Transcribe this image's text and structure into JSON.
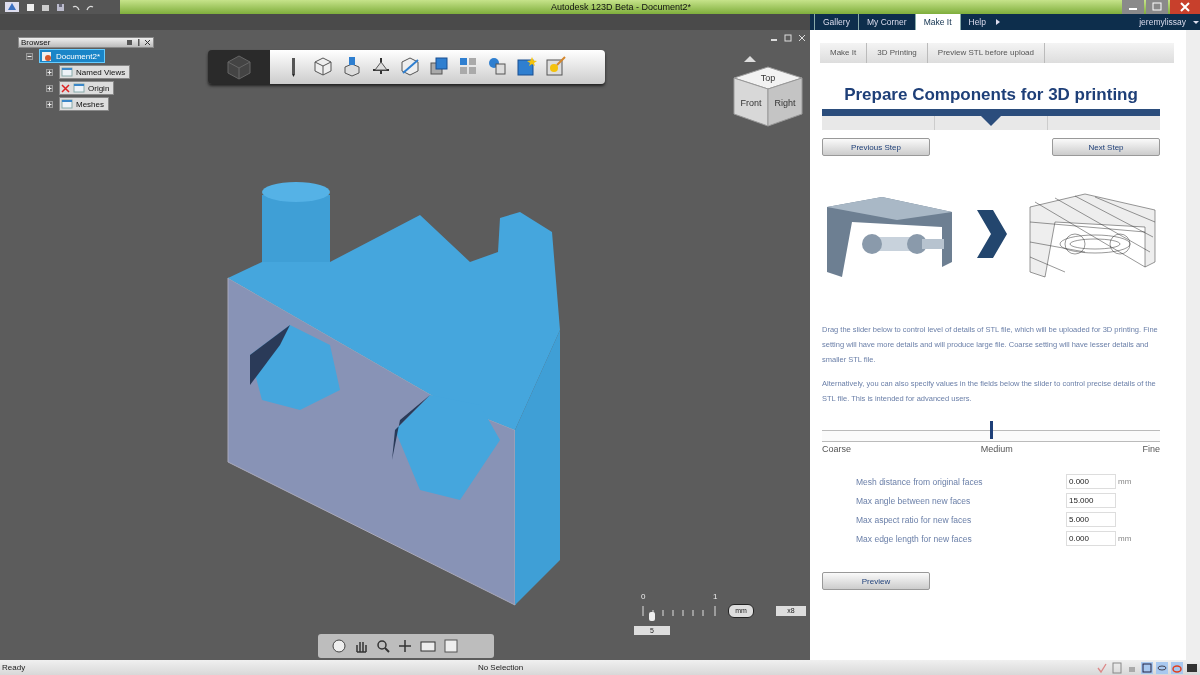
{
  "title_bar": {
    "title": "Autodesk 123D Beta - Document2*"
  },
  "browser": {
    "title": "Browser",
    "tree": [
      {
        "label": "Document2*",
        "selected": true,
        "expanded": true,
        "children": [
          {
            "label": "Named Views",
            "selected": false,
            "expanded": false
          },
          {
            "label": "Origin",
            "selected": false,
            "expanded": false
          },
          {
            "label": "Meshes",
            "selected": false,
            "expanded": false
          }
        ]
      }
    ]
  },
  "view_cube": {
    "faces": [
      "Top",
      "Front",
      "Right"
    ]
  },
  "scale_widget": {
    "ticks": [
      "0",
      "1"
    ],
    "value": "5",
    "unit": "mm",
    "zoom": "x8"
  },
  "web_tabs": [
    {
      "label": "Gallery",
      "selected": false
    },
    {
      "label": "My Corner",
      "selected": false
    },
    {
      "label": "Make It",
      "selected": true
    },
    {
      "label": "Help",
      "selected": false
    }
  ],
  "user": "jeremylissay",
  "breadcrumbs": [
    "Make It",
    "3D Printing",
    "Preview STL before upload"
  ],
  "heading": "Prepare Components for 3D printing",
  "steps": [
    {
      "selected": false
    },
    {
      "selected": true
    },
    {
      "selected": false
    }
  ],
  "step_buttons": [
    "Previous Step",
    "Next Step"
  ],
  "paragraphs": [
    "Drag the slider below to control level of details of STL file, which will be uploaded for 3D printing. Fine setting will have more details and will produce large file. Coarse setting will have lesser details and smaller STL file.",
    "Alternatively, you can also specify values in the fields below the slider to control precise details of the STL file. This is intended for advanced users."
  ],
  "detail_slider": {
    "level": 0.5,
    "labels": [
      "Coarse",
      "Medium",
      "Fine"
    ]
  },
  "fields": [
    {
      "label": "Mesh distance from original faces",
      "value": "0.000",
      "unit": "mm"
    },
    {
      "label": "Max angle between new faces",
      "value": "15.000"
    },
    {
      "label": "Max aspect ratio for new faces",
      "value": "5.000"
    },
    {
      "label": "Max edge length for new faces",
      "value": "0.000",
      "unit": "mm"
    }
  ],
  "preview_button": "Preview",
  "status_bar": {
    "left": "Ready",
    "center": "No Selection"
  }
}
